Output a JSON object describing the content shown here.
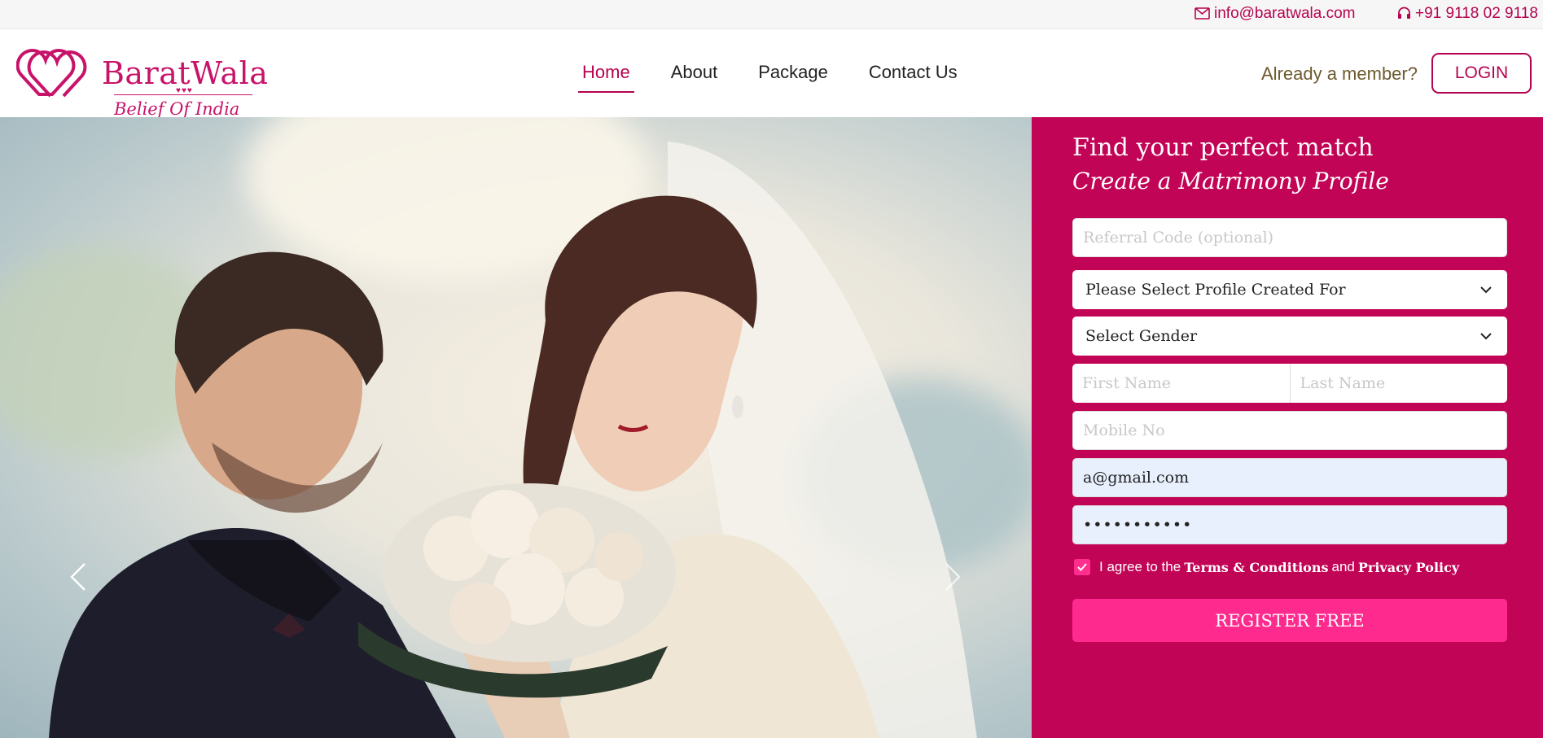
{
  "topbar": {
    "email": "info@baratwala.com",
    "phone": "+91 9118 02 9118"
  },
  "brand": {
    "name": "BaratWala",
    "tagline": "Belief Of India",
    "color": "#c8136a"
  },
  "nav": {
    "items": [
      {
        "label": "Home",
        "active": true
      },
      {
        "label": "About",
        "active": false
      },
      {
        "label": "Package",
        "active": false
      },
      {
        "label": "Contact Us",
        "active": false
      }
    ]
  },
  "header": {
    "member_text": "Already a member?",
    "login_label": "LOGIN"
  },
  "hero": {
    "image": "bride-and-groom-with-bouquet",
    "prev_icon": "chevron-left-icon",
    "next_icon": "chevron-right-icon"
  },
  "register": {
    "title": "Find your perfect match",
    "subtitle": "Create a Matrimony Profile",
    "referral_placeholder": "Referral Code (optional)",
    "profile_for": "Please Select Profile Created For",
    "gender": "Select Gender",
    "first_name_placeholder": "First Name",
    "last_name_placeholder": "Last Name",
    "mobile_placeholder": "Mobile No",
    "email_value": "a@gmail.com",
    "password_value": "•••••••••••",
    "agree_prefix": "I agree to the",
    "terms": "Terms & Conditions",
    "agree_and": "and",
    "privacy": "Privacy Policy",
    "agree_checked": true,
    "button_label": "REGISTER FREE",
    "panel_color": "#c20456",
    "button_color": "#ff2a8e"
  }
}
